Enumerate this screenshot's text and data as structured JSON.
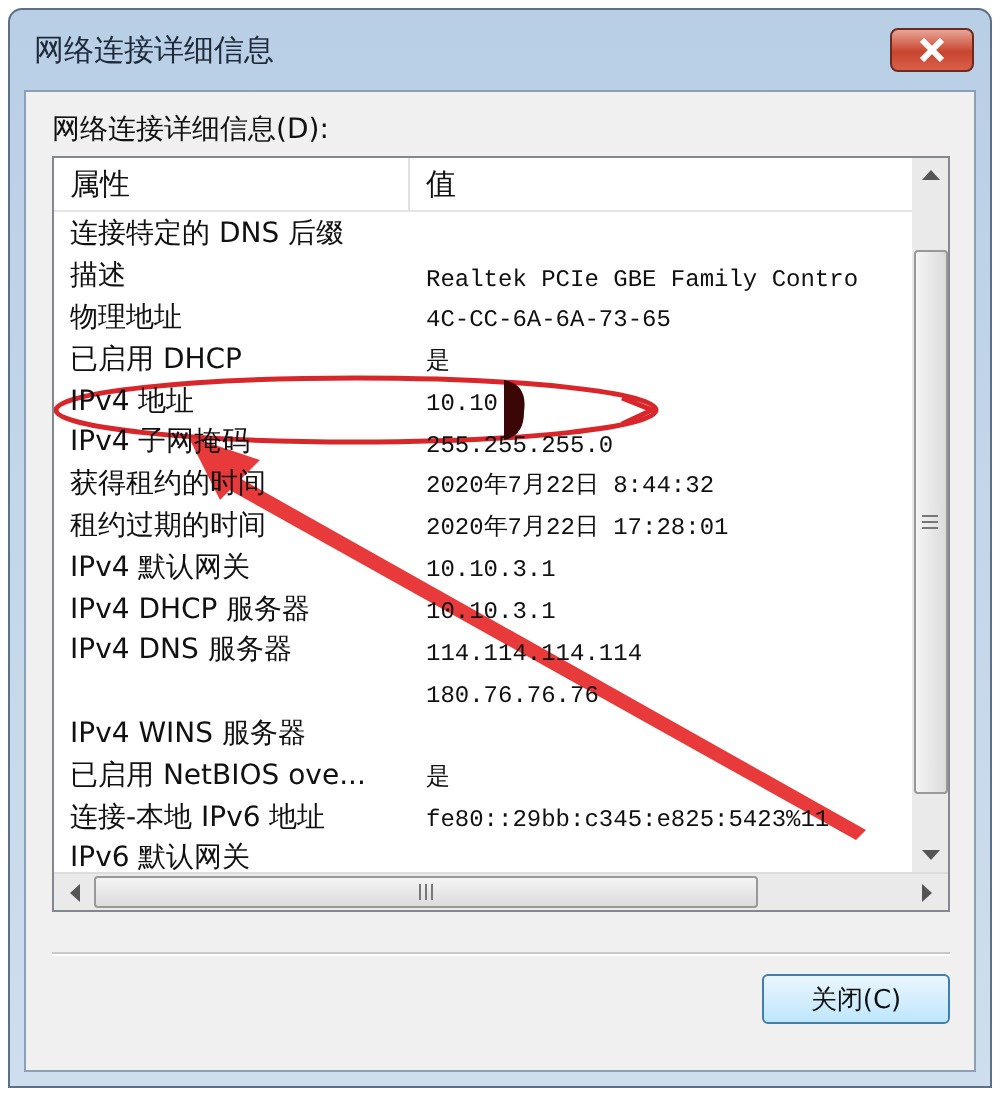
{
  "window": {
    "title": "网络连接详细信息"
  },
  "details": {
    "label": "网络连接详细信息(D):",
    "columns": [
      "属性",
      "值"
    ],
    "rows": [
      {
        "property": "连接特定的 DNS 后缀"
      },
      {
        "property": "描述",
        "value": "Realtek PCIe GBE Family Contro"
      },
      {
        "property": "物理地址",
        "value": "4C-CC-6A-6A-73-65"
      },
      {
        "property": "已启用 DHCP",
        "value": "是"
      },
      {
        "property": "IPv4 地址",
        "value": "10.10"
      },
      {
        "property": "IPv4 子网掩码",
        "value": "255.255.255.0"
      },
      {
        "property": "获得租约的时间",
        "value": "2020年7月22日 8:44:32"
      },
      {
        "property": "租约过期的时间",
        "value": "2020年7月22日 17:28:01"
      },
      {
        "property": "IPv4 默认网关",
        "value": "10.10.3.1"
      },
      {
        "property": "IPv4 DHCP 服务器",
        "value": "10.10.3.1"
      },
      {
        "property": "IPv4 DNS 服务器",
        "value": "114.114.114.114"
      },
      {
        "value": "180.76.76.76"
      },
      {
        "property": "IPv4 WINS 服务器"
      },
      {
        "property": "已启用 NetBIOS ove...",
        "value": "是"
      },
      {
        "property": "连接-本地 IPv6 地址",
        "value": "fe80::29bb:c345:e825:5423%11"
      },
      {
        "property": "IPv6 默认网关"
      }
    ]
  },
  "buttons": [
    "关闭(C)"
  ]
}
